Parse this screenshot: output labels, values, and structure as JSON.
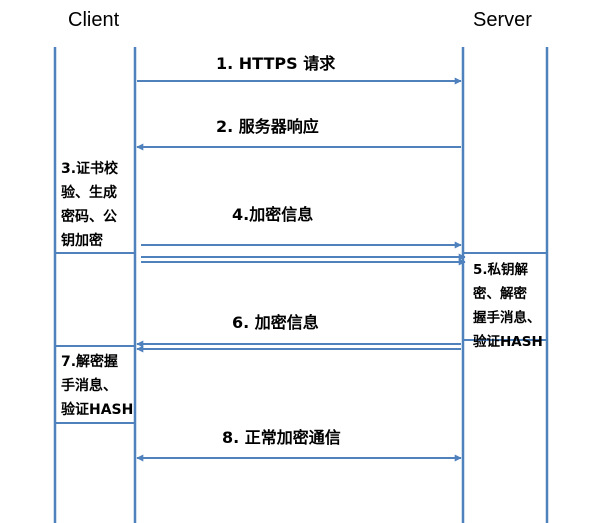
{
  "colors": {
    "line": "#4f81bd",
    "text": "#000000",
    "background": "#ffffff"
  },
  "actors": {
    "client": "Client",
    "server": "Server"
  },
  "messages": [
    {
      "label": "1. HTTPS 请求",
      "direction": "client-to-server"
    },
    {
      "label": "2. 服务器响应",
      "direction": "server-to-client"
    },
    {
      "label": "4.加密信息",
      "direction": "client-to-server"
    },
    {
      "label": "6. 加密信息",
      "direction": "server-to-client"
    },
    {
      "label": "8. 正常加密通信",
      "direction": "bidirectional"
    }
  ],
  "activations": [
    {
      "side": "client",
      "lines": [
        "3.证书校",
        "验、生成",
        "密码、公",
        "钥加密"
      ]
    },
    {
      "side": "server",
      "lines": [
        "5.私钥解",
        "密、解密",
        "握手消息、",
        "验证HASH"
      ]
    },
    {
      "side": "client",
      "lines": [
        "7.解密握",
        "手消息、",
        "验证HASH"
      ]
    }
  ]
}
